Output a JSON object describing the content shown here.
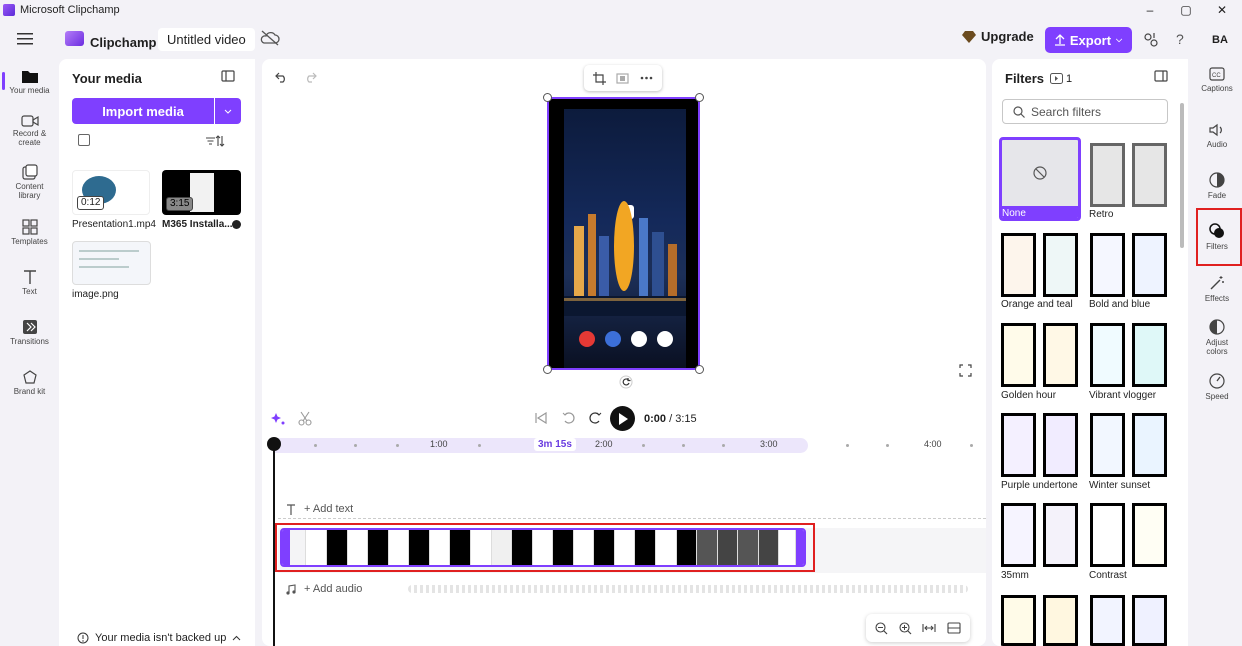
{
  "window": {
    "title": "Microsoft Clipchamp",
    "minimize": "–",
    "maximize": "▢",
    "close": "✕"
  },
  "header": {
    "brand": "Clipchamp",
    "video_title": "Untitled video",
    "upgrade_label": "Upgrade",
    "export_label": "Export",
    "help": "?",
    "avatar_initials": "BA"
  },
  "left_rail": [
    {
      "label": "Your media",
      "icon": "folder-icon"
    },
    {
      "label": "Record & create",
      "icon": "camera-icon"
    },
    {
      "label": "Content library",
      "icon": "library-icon"
    },
    {
      "label": "Templates",
      "icon": "templates-icon"
    },
    {
      "label": "Text",
      "icon": "text-icon"
    },
    {
      "label": "Transitions",
      "icon": "transitions-icon"
    },
    {
      "label": "Brand kit",
      "icon": "brand-kit-icon"
    }
  ],
  "media_panel": {
    "title": "Your media",
    "import_label": "Import media",
    "items": [
      {
        "name": "Presentation1.mp4",
        "duration": "0:12"
      },
      {
        "name": "M365 Installa...",
        "duration": "3:15"
      },
      {
        "name": "image.png",
        "duration": ""
      }
    ],
    "backup_notice": "Your media isn't backed up"
  },
  "timeline": {
    "current_time": "0:00",
    "total_time": "/ 3:15",
    "selection_length": "3m 15s",
    "ticks": [
      "1:00",
      "2:00",
      "3:00",
      "4:00"
    ],
    "add_text": "+ Add text",
    "add_audio": "+ Add audio"
  },
  "filters_panel": {
    "title": "Filters",
    "applied_count": "1",
    "search_placeholder": "Search filters",
    "filters": [
      "None",
      "Retro",
      "Orange and teal",
      "Bold and blue",
      "Golden hour",
      "Vibrant vlogger",
      "Purple undertone",
      "Winter sunset",
      "35mm",
      "Contrast"
    ],
    "selected": "None"
  },
  "right_rail": [
    {
      "label": "Captions",
      "icon": "captions-icon"
    },
    {
      "label": "Audio",
      "icon": "speaker-icon"
    },
    {
      "label": "Fade",
      "icon": "fade-icon"
    },
    {
      "label": "Filters",
      "icon": "filters-icon"
    },
    {
      "label": "Effects",
      "icon": "magic-wand-icon"
    },
    {
      "label": "Adjust colors",
      "icon": "adjust-colors-icon"
    },
    {
      "label": "Speed",
      "icon": "speedometer-icon"
    }
  ],
  "colors": {
    "accent": "#7f3fff",
    "highlight": "#e02020"
  }
}
